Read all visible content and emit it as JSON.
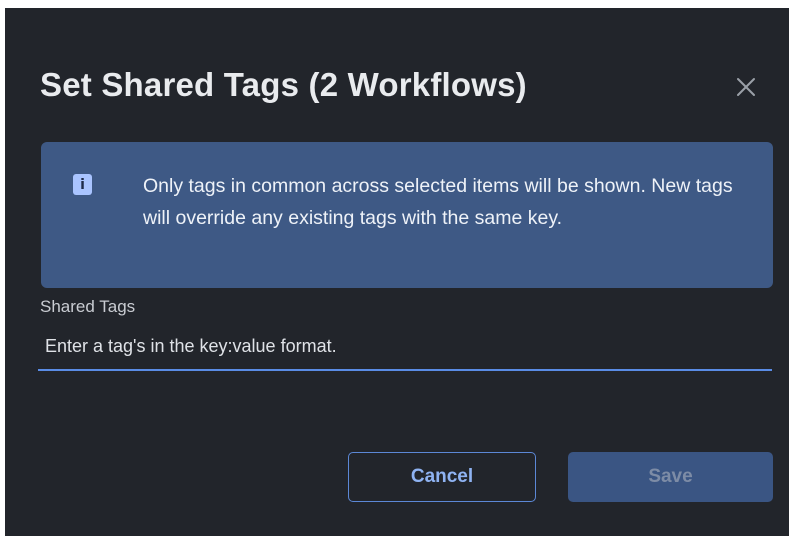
{
  "dialog": {
    "title": "Set Shared Tags (2 Workflows)",
    "close_icon": "close-icon"
  },
  "banner": {
    "icon": "info-icon",
    "icon_glyph": "i",
    "message": "Only tags in common across selected items will be shown. New tags will override any existing tags with the same key."
  },
  "field": {
    "label": "Shared Tags",
    "placeholder": "Enter a tag's in the key:value format.",
    "value": ""
  },
  "buttons": {
    "cancel_label": "Cancel",
    "save_label": "Save"
  },
  "colors": {
    "dialog_bg": "#22252b",
    "banner_bg": "#3e5985",
    "accent": "#5a8ce6",
    "save_disabled_bg": "#3a5583"
  }
}
